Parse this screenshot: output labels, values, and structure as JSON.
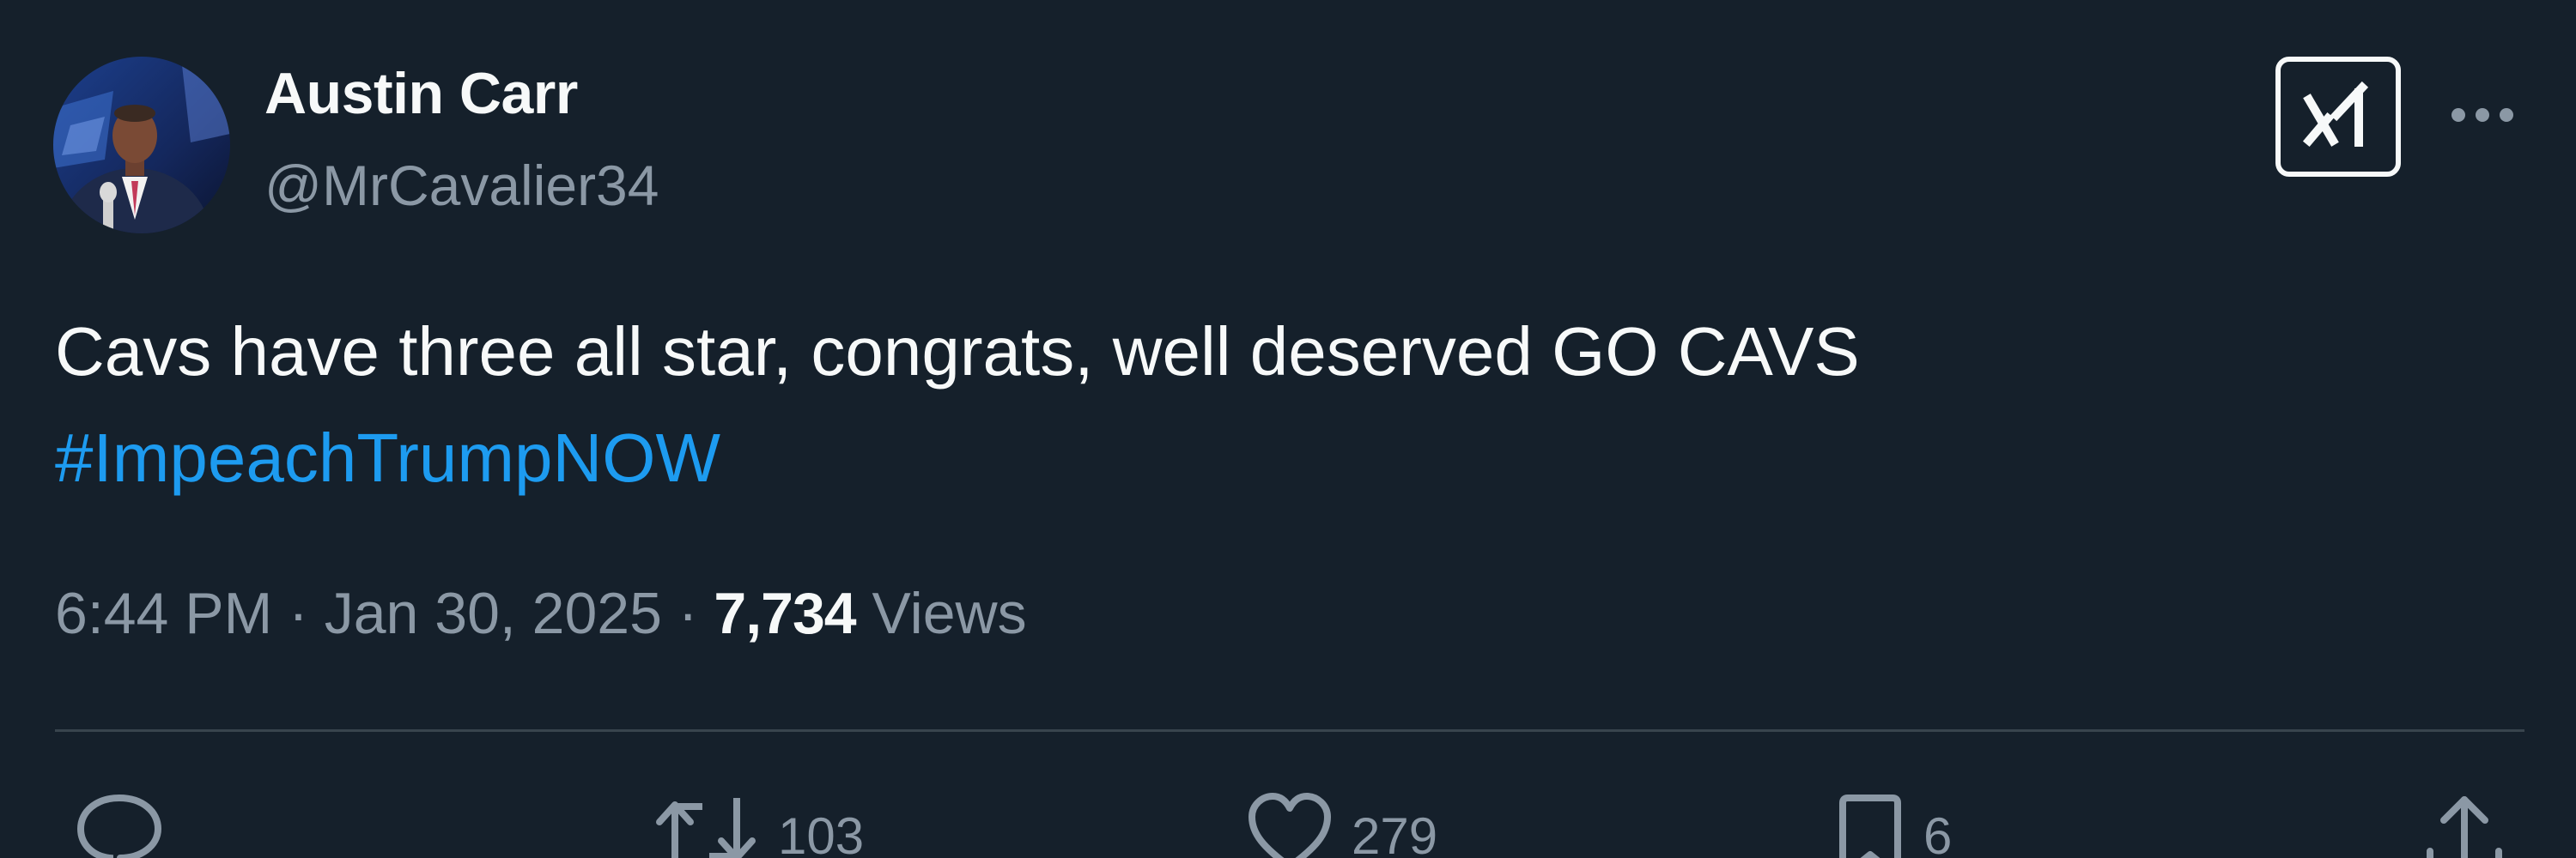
{
  "author": {
    "display_name": "Austin Carr",
    "handle": "@MrCavalier34"
  },
  "tweet": {
    "text": "Cavs have three all star, congrats, well deserved GO CAVS",
    "hashtag": "#ImpeachTrumpNOW"
  },
  "meta": {
    "time": "6:44 PM",
    "separator": "·",
    "date": "Jan 30, 2025",
    "views_count": "7,734",
    "views_label": "Views"
  },
  "actions": {
    "replies": "",
    "retweets": "103",
    "likes": "279",
    "bookmarks": "6"
  },
  "icons": {
    "grok": "grok-icon",
    "more": "more-dots-icon",
    "reply": "reply-icon",
    "retweet": "retweet-icon",
    "like": "heart-icon",
    "bookmark": "bookmark-icon",
    "share": "share-icon"
  },
  "colors": {
    "background": "#15202b",
    "text_primary": "#f7f9f9",
    "text_secondary": "#8b98a5",
    "link": "#1d9bf0",
    "divider": "#38444d"
  }
}
